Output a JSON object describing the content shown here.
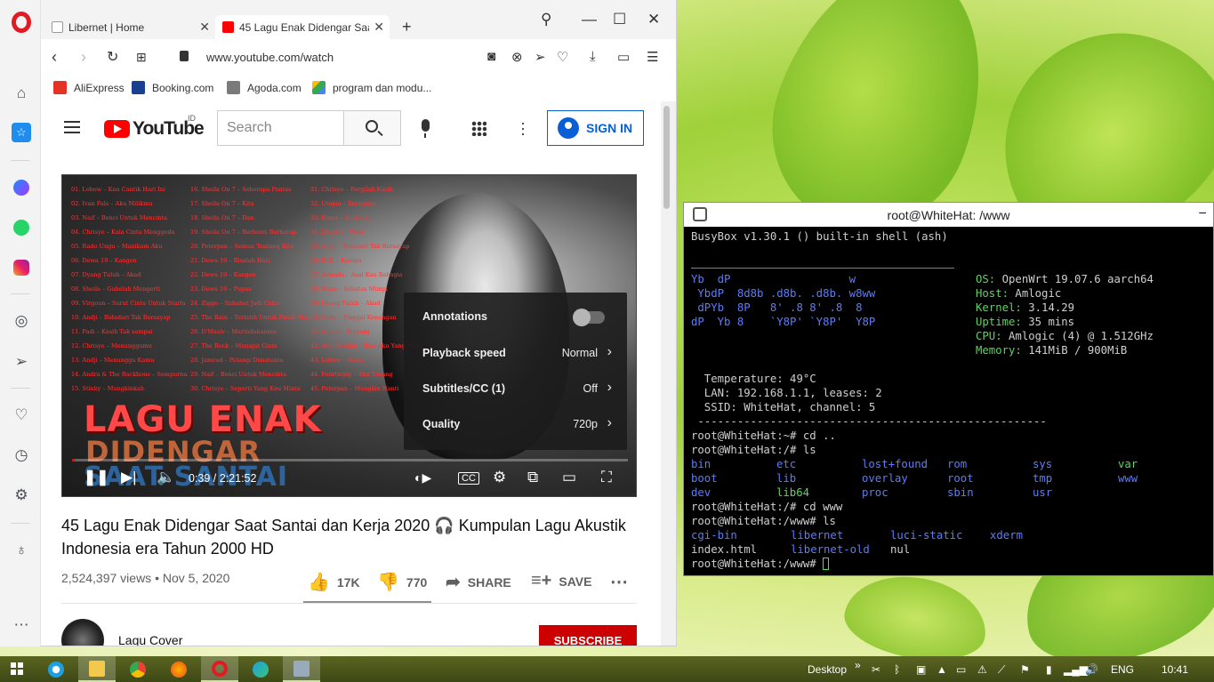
{
  "browser": {
    "tabs": [
      {
        "label": "Libernet | Home",
        "active": false
      },
      {
        "label": "45 Lagu Enak Didengar Saat",
        "active": true
      }
    ],
    "new_tab": "+",
    "url": "www.youtube.com/watch",
    "bookmarks": [
      "AliExpress",
      "Booking.com",
      "Agoda.com",
      "program dan modu..."
    ],
    "bookmark_colors": [
      "#e43225",
      "#1b3f8f",
      "#7a7a7a",
      "#34a853"
    ]
  },
  "youtube": {
    "logo": "YouTube",
    "region": "ID",
    "search_placeholder": "Search",
    "sign_in": "SIGN IN",
    "player": {
      "songs_col1": [
        "01. Lobow – Kau Cantik Hari Ini",
        "02. Ivan Fals – Aku Milikmu",
        "03. Naif – Benci Untuk Mencinta",
        "04. Chrisye – Kala Cinta Menggoda",
        "05. Rado Ungu – Manikam Aku",
        "06. Dewa 19 – Kangen",
        "07. Dyang Tulub – Akad",
        "08. Sheila – Gabelah Mengerti",
        "09. Virgoun – Surat Cinta Untuk Starla",
        "10. Andji – Bidadari Tak Bersayap",
        "11. Padi – Kasih Tak sampai",
        "12. Chrisye – Menunggumu",
        "13. Andji – Menunggu Kamu",
        "14. Andra & The Backbone – Sempurna",
        "15. Stinky – Mungkinkah"
      ],
      "songs_col2": [
        "16. Sheila On 7 – Seberapa Pantas",
        "17. Sheila On 7 – Kita",
        "18. Sheila On 7 – Dan",
        "19. Sheila On 7 – Berhenti Berharap",
        "20. Peterpan – Semua Tentang Kita",
        "21. Dewa 19 – Risalah Hati",
        "22. Dewa 19 – Kangen",
        "23. Dewa 19 – Pupus",
        "24. Ziggo – Sahabat Jadi Cinta",
        "25. The Rain – Terlatih Untuk Patah Hati",
        "26. D'Masiv – Merindukanmu",
        "27. The Rock – Munajat Cinta",
        "28. Jamrud – Pelangi Dimatamu",
        "29. Naif – Benci Untuk Mencinta",
        "30. Chrisye – Seperti Yang Kau Minta"
      ],
      "songs_col3": [
        "31. Chrisye – Pergilah Kasih",
        "32. Utopia – Rerupiisa",
        "33. Ruma – Bertahan",
        "34. Jikustik – Puisi",
        "35. Andji – Bidadari Tak Bersayap",
        "36. BCL – Karena",
        "37. Armada – Asal Kau Bahagia",
        "38. Nano – Sebatas Mimpi",
        "39. Dyang Tulub – Akad",
        "40. Gaby – Tinggal Kenangan",
        "41. Anima – Bintang",
        "42. Aldi Maldini – Biar Aku Yang Pergi",
        "43. Lobow – Salah",
        "44. Fourtwnty – Aku Tenang",
        "45. Peterpan – Mungkin Nanti"
      ],
      "title_line1": "LAGU ENAK",
      "title_line2": "DIDENGAR",
      "title_line3": "SAAT SANTAI",
      "settings": [
        {
          "label": "Annotations",
          "value": ""
        },
        {
          "label": "Playback speed",
          "value": "Normal"
        },
        {
          "label": "Subtitles/CC (1)",
          "value": "Off"
        },
        {
          "label": "Quality",
          "value": "720p"
        }
      ],
      "time": "0:39 / 2:21:52",
      "progress": 0.005
    },
    "video_title": "45 Lagu Enak Didengar Saat Santai dan Kerja 2020 🎧 Kumpulan Lagu Akustik Indonesia era Tahun 2000 HD",
    "views": "2,524,397 views • Nov 5, 2020",
    "likes": "17K",
    "dislikes": "770",
    "share": "SHARE",
    "save": "SAVE",
    "channel": "Lagu Cover",
    "subscribe": "SUBSCRIBE"
  },
  "terminal": {
    "title": "root@WhiteHat: /www",
    "minimize": "–",
    "banner": "BusyBox v1.30.1 () built-in shell (ash)",
    "logo": [
      "Yb  dP                  w",
      " YbdP  8d8b .d8b. .d8b. w8ww",
      " dPYb  8P   8' .8 8' .8  8",
      "dP  Yb 8    `Y8P' `Y8P'  Y8P"
    ],
    "info": [
      {
        "k": "OS:",
        "v": " OpenWrt 19.07.6 aarch64"
      },
      {
        "k": "Host:",
        "v": " Amlogic"
      },
      {
        "k": "Kernel:",
        "v": " 3.14.29"
      },
      {
        "k": "Uptime:",
        "v": " 35 mins"
      },
      {
        "k": "CPU:",
        "v": " Amlogic (4) @ 1.512GHz"
      },
      {
        "k": "Memory:",
        "v": " 141MiB / 900MiB"
      }
    ],
    "temperature": "  Temperature: 49°C",
    "lan": "  LAN: 192.168.1.1, leases: 2",
    "ssid": "  SSID: WhiteHat, channel: 5",
    "dashes": " -----------------------------------------------------",
    "cmd1": "root@WhiteHat:~# cd ..",
    "cmd2": "root@WhiteHat:/# ls",
    "ls_root": [
      [
        "bin",
        "etc",
        "lost+found",
        "rom",
        "sys",
        "var"
      ],
      [
        "boot",
        "lib",
        "overlay",
        "root",
        "tmp",
        "www"
      ],
      [
        "dev",
        "lib64",
        "proc",
        "sbin",
        "usr",
        ""
      ]
    ],
    "cmd3": "root@WhiteHat:/# cd www",
    "cmd4": "root@WhiteHat:/www# ls",
    "ls_www": [
      [
        "cgi-bin",
        "libernet",
        "luci-static",
        "xderm"
      ],
      [
        "index.html",
        "libernet-old",
        "nul",
        ""
      ]
    ],
    "prompt": "root@WhiteHat:/www# "
  },
  "taskbar": {
    "desktop": "Desktop",
    "chevron": "»",
    "lang": "ENG",
    "time": "10:41"
  }
}
